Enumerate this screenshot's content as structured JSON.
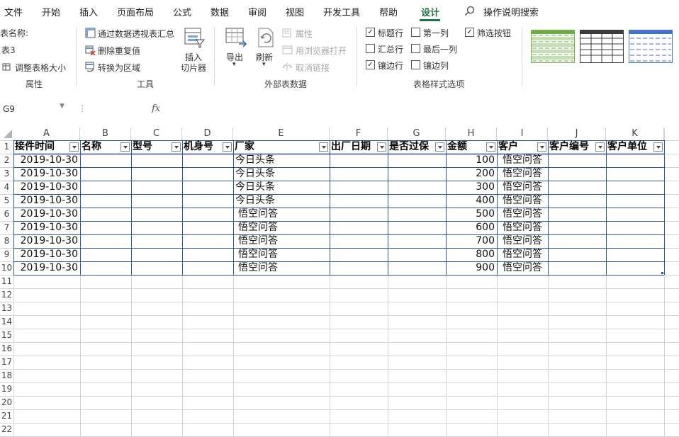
{
  "menu": {
    "items": [
      "文件",
      "开始",
      "插入",
      "页面布局",
      "公式",
      "数据",
      "审阅",
      "视图",
      "开发工具",
      "帮助",
      "设计"
    ],
    "active": "设计",
    "search_label": "操作说明搜索"
  },
  "ribbon": {
    "properties": {
      "table_name_label": "表名称:",
      "table_name_value": "表3",
      "resize_label": "调整表格大小",
      "group_label": "属性"
    },
    "tools": {
      "pivot_label": "通过数据透视表汇总",
      "remove_dup_label": "删除重复值",
      "convert_label": "转换为区域",
      "slicer_label_1": "插入",
      "slicer_label_2": "切片器",
      "group_label": "工具"
    },
    "external": {
      "export_label": "导出",
      "refresh_label": "刷新",
      "properties_label": "属性",
      "browser_label": "用浏览器打开",
      "unlink_label": "取消链接",
      "group_label": "外部表数据"
    },
    "style_options": {
      "header_row": {
        "label": "标题行",
        "checked": true
      },
      "total_row": {
        "label": "汇总行",
        "checked": false
      },
      "banded_rows": {
        "label": "镶边行",
        "checked": true
      },
      "first_column": {
        "label": "第一列",
        "checked": false
      },
      "last_column": {
        "label": "最后一列",
        "checked": false
      },
      "banded_columns": {
        "label": "镶边列",
        "checked": false
      },
      "filter_button": {
        "label": "筛选按钮",
        "checked": true
      },
      "group_label": "表格样式选项"
    },
    "styles": {
      "accent_green": "#70ad47",
      "accent_dark": "#3b3b3b",
      "accent_blue": "#4472c4"
    }
  },
  "formula_bar": {
    "name_box": "G9",
    "fx_label": "fx",
    "formula": ""
  },
  "sheet": {
    "columns": [
      "A",
      "B",
      "C",
      "D",
      "E",
      "F",
      "G",
      "H",
      "I",
      "J",
      "K"
    ],
    "rows": [
      "1",
      "2",
      "3",
      "4",
      "5",
      "6",
      "7",
      "8",
      "9",
      "10",
      "11",
      "12",
      "13",
      "14",
      "15",
      "16",
      "17",
      "18",
      "19",
      "20",
      "21",
      "22"
    ],
    "headers": [
      "接件时间",
      "名称",
      "型号",
      "机身号",
      "厂家",
      "出厂日期",
      "是否过保",
      "金额",
      "客户",
      "客户编号",
      "客户单位"
    ],
    "data": [
      [
        "2019-10-30",
        "",
        "",
        "",
        "今日头条",
        "",
        "",
        "100",
        "悟空问答",
        "",
        ""
      ],
      [
        "2019-10-30",
        "",
        "",
        "",
        "今日头条",
        "",
        "",
        "200",
        "悟空问答",
        "",
        ""
      ],
      [
        "2019-10-30",
        "",
        "",
        "",
        "今日头条",
        "",
        "",
        "300",
        "悟空问答",
        "",
        ""
      ],
      [
        "2019-10-30",
        "",
        "",
        "",
        "今日头条",
        "",
        "",
        "400",
        "悟空问答",
        "",
        ""
      ],
      [
        "2019-10-30",
        "",
        "",
        "",
        "悟空问答",
        "",
        "",
        "500",
        "悟空问答",
        "",
        ""
      ],
      [
        "2019-10-30",
        "",
        "",
        "",
        "悟空问答",
        "",
        "",
        "600",
        "悟空问答",
        "",
        ""
      ],
      [
        "2019-10-30",
        "",
        "",
        "",
        "悟空问答",
        "",
        "",
        "700",
        "悟空问答",
        "",
        ""
      ],
      [
        "2019-10-30",
        "",
        "",
        "",
        "悟空问答",
        "",
        "",
        "800",
        "悟空问答",
        "",
        ""
      ],
      [
        "2019-10-30",
        "",
        "",
        "",
        "悟空问答",
        "",
        "",
        "900",
        "悟空问答",
        "",
        ""
      ]
    ],
    "table_border_color": "#2f5597",
    "grid_color": "#d4d4d4"
  }
}
